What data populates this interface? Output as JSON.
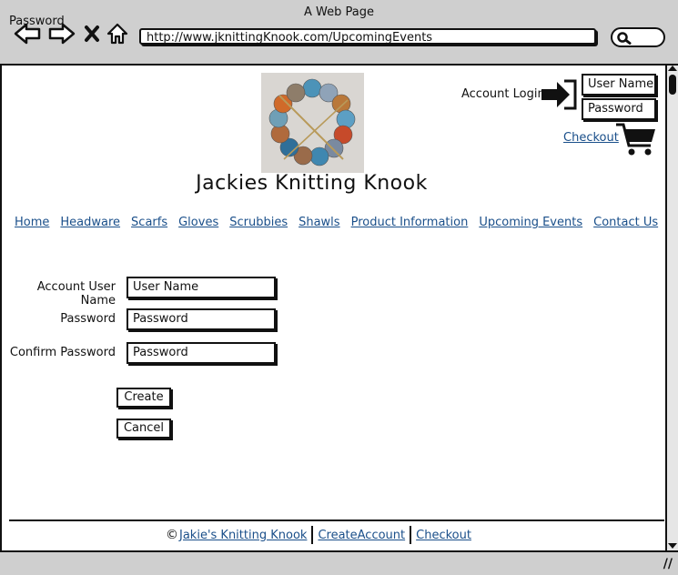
{
  "browser": {
    "window_title": "A Web Page",
    "overlay_label": "Password",
    "url": "http://www.jknittingKnook.com/UpcomingEvents"
  },
  "header": {
    "site_title": "Jackies Knitting Knook",
    "account_login_label": "Account Login",
    "username_placeholder": "User Name",
    "password_placeholder": "Password",
    "checkout_link": "Checkout"
  },
  "nav": {
    "items": [
      {
        "label": "Home"
      },
      {
        "label": "Headware"
      },
      {
        "label": "Scarfs"
      },
      {
        "label": "Gloves"
      },
      {
        "label": "Scrubbies"
      },
      {
        "label": "Shawls"
      },
      {
        "label": "Product Information"
      },
      {
        "label": "Upcoming Events"
      },
      {
        "label": "Contact Us"
      }
    ]
  },
  "form": {
    "username_label": "Account User Name",
    "username_value": "User Name",
    "password_label": "Password",
    "password_value": "Password",
    "confirm_label": "Confirm Password",
    "confirm_value": "Password",
    "create_button": "Create",
    "cancel_button": "Cancel"
  },
  "footer": {
    "copyright_symbol": "©",
    "links": [
      "Jakie's Knitting Knook",
      "CreateAccount",
      "Checkout"
    ]
  },
  "colors": {
    "link": "#1a4f8a",
    "chrome": "#cfcfcf"
  }
}
